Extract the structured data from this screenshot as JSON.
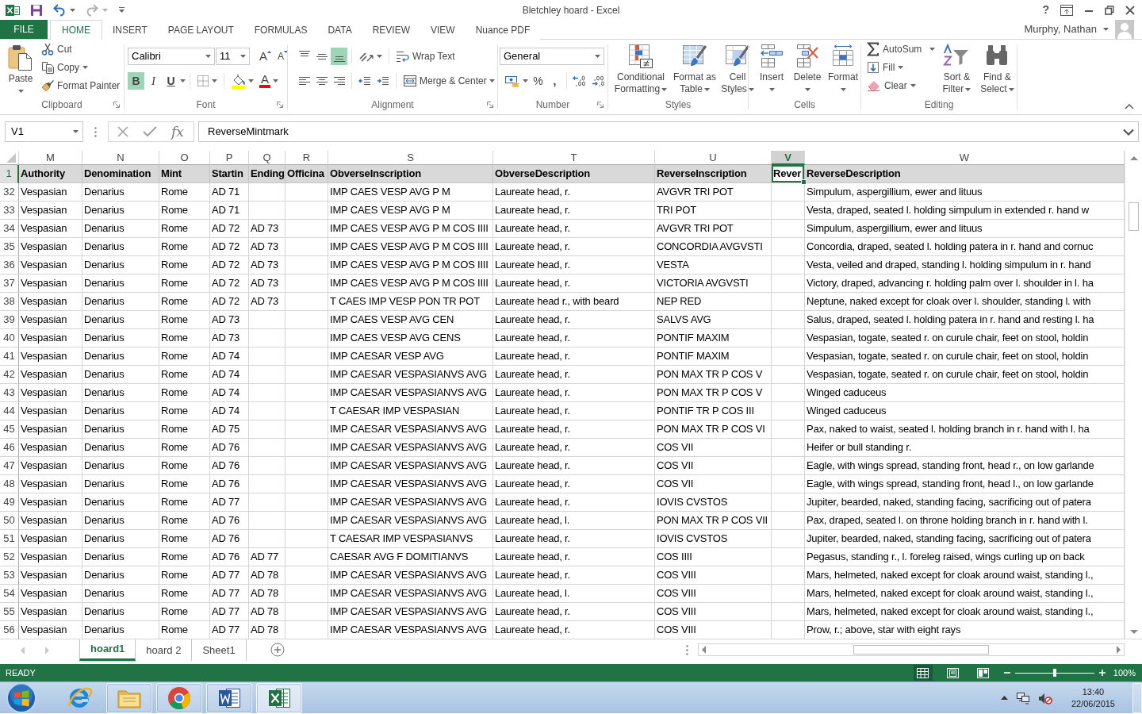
{
  "window": {
    "title": "Bletchley hoard - Excel",
    "help": "?"
  },
  "ribbon_tabs": [
    {
      "label": "FILE",
      "kind": "file",
      "selected": false
    },
    {
      "label": "HOME",
      "kind": "tab",
      "selected": true
    },
    {
      "label": "INSERT",
      "kind": "tab",
      "selected": false
    },
    {
      "label": "PAGE LAYOUT",
      "kind": "tab",
      "selected": false
    },
    {
      "label": "FORMULAS",
      "kind": "tab",
      "selected": false
    },
    {
      "label": "DATA",
      "kind": "tab",
      "selected": false
    },
    {
      "label": "REVIEW",
      "kind": "tab",
      "selected": false
    },
    {
      "label": "VIEW",
      "kind": "tab",
      "selected": false
    },
    {
      "label": "Nuance PDF",
      "kind": "tab",
      "selected": false
    }
  ],
  "account": {
    "name": "Murphy, Nathan"
  },
  "ribbon": {
    "clipboard": {
      "label": "Clipboard",
      "paste": "Paste",
      "cut": "Cut",
      "copy": "Copy",
      "format_painter": "Format Painter"
    },
    "font": {
      "label": "Font",
      "font_name": "Calibri",
      "font_size": "11",
      "grow": "A",
      "shrink": "A",
      "bold": {
        "label": "B",
        "on": true
      },
      "italic": {
        "label": "I",
        "on": false
      },
      "underline": {
        "label": "U",
        "on": false
      },
      "font_color": "A"
    },
    "alignment": {
      "label": "Alignment",
      "vertical": [
        {
          "kind": "top",
          "selected": false
        },
        {
          "kind": "middle",
          "selected": false
        },
        {
          "kind": "bottom",
          "selected": true
        }
      ],
      "horizontal": [
        {
          "kind": "left",
          "selected": false
        },
        {
          "kind": "center",
          "selected": false
        },
        {
          "kind": "right",
          "selected": false
        }
      ],
      "wrap_text": "Wrap Text",
      "merge_center": "Merge & Center"
    },
    "number": {
      "label": "Number",
      "format": "General",
      "percent": "%",
      "comma": ","
    },
    "styles": {
      "label": "Styles",
      "buttons": [
        "Conditional Formatting",
        "Format as Table",
        "Cell Styles"
      ]
    },
    "cells": {
      "label": "Cells",
      "buttons": [
        "Insert",
        "Delete",
        "Format"
      ]
    },
    "editing": {
      "label": "Editing",
      "autosum": "AutoSum",
      "fill": "Fill",
      "clear": "Clear",
      "sort_filter": "Sort & Filter",
      "find_select": "Find & Select"
    }
  },
  "formula_bar": {
    "name_box": "V1",
    "function_label": "fx",
    "formula": "ReverseMintmark"
  },
  "sheet": {
    "columns": [
      {
        "letter": "M",
        "selected": false
      },
      {
        "letter": "N",
        "selected": false
      },
      {
        "letter": "O",
        "selected": false
      },
      {
        "letter": "P",
        "selected": false
      },
      {
        "letter": "Q",
        "selected": false
      },
      {
        "letter": "R",
        "selected": false
      },
      {
        "letter": "S",
        "selected": false
      },
      {
        "letter": "T",
        "selected": false
      },
      {
        "letter": "U",
        "selected": false
      },
      {
        "letter": "V",
        "selected": true
      },
      {
        "letter": "W",
        "selected": false
      }
    ],
    "header_row": {
      "number": "1",
      "selected": true,
      "authority": "Authority",
      "denomination": "Denomination",
      "mint": "Mint",
      "starting": "Startin",
      "ending": "Ending",
      "officina": "Officina",
      "obverse_inscription": "ObverseInscription",
      "obverse_description": "ObverseDescription",
      "reverse_inscription": "ReverseInscription",
      "reverse_mintmark": "Rever",
      "reverse_description": "ReverseDescription"
    },
    "rows": [
      {
        "number": "32",
        "selected": false,
        "authority": "Vespasian",
        "denomination": "Denarius",
        "mint": "Rome",
        "starting": "AD 71",
        "obverse_inscription": "IMP CAES VESP AVG P M",
        "obverse_description": "Laureate head, r.",
        "reverse_inscription": "AVGVR TRI POT",
        "reverse_description": "Simpulum, aspergillium, ewer and lituus"
      },
      {
        "number": "33",
        "selected": false,
        "authority": "Vespasian",
        "denomination": "Denarius",
        "mint": "Rome",
        "starting": "AD 71",
        "obverse_inscription": "IMP CAES VESP AVG P M",
        "obverse_description": "Laureate head, r.",
        "reverse_inscription": "TRI POT",
        "reverse_description": "Vesta, draped, seated l. holding simpulum in extended r. hand w"
      },
      {
        "number": "34",
        "selected": false,
        "authority": "Vespasian",
        "denomination": "Denarius",
        "mint": "Rome",
        "starting": "AD 72",
        "ending": "AD 73",
        "obverse_inscription": "IMP CAES VESP AVG P M COS IIII",
        "obverse_description": "Laureate head, r.",
        "reverse_inscription": "AVGVR TRI POT",
        "reverse_description": "Simpulum, aspergillium, ewer and lituus"
      },
      {
        "number": "35",
        "selected": false,
        "authority": "Vespasian",
        "denomination": "Denarius",
        "mint": "Rome",
        "starting": "AD 72",
        "ending": "AD 73",
        "obverse_inscription": "IMP CAES VESP AVG P M COS IIII",
        "obverse_description": "Laureate head, r.",
        "reverse_inscription": "CONCORDIA AVGVSTI",
        "reverse_description": "Concordia, draped, seated l. holding patera in r. hand and cornuc"
      },
      {
        "number": "36",
        "selected": false,
        "authority": "Vespasian",
        "denomination": "Denarius",
        "mint": "Rome",
        "starting": "AD 72",
        "ending": "AD 73",
        "obverse_inscription": "IMP CAES VESP AVG P M COS IIII",
        "obverse_description": "Laureate head, r.",
        "reverse_inscription": "VESTA",
        "reverse_description": "Vesta, veiled and draped, standing l. holding simpulum in r. hand"
      },
      {
        "number": "37",
        "selected": false,
        "authority": "Vespasian",
        "denomination": "Denarius",
        "mint": "Rome",
        "starting": "AD 72",
        "ending": "AD 73",
        "obverse_inscription": "IMP CAES VESP AVG P M COS IIII",
        "obverse_description": "Laureate head, r.",
        "reverse_inscription": "VICTORIA AVGVSTI",
        "reverse_description": "Victory, draped, advancing r. holding palm over l. shoulder in l. ha"
      },
      {
        "number": "38",
        "selected": false,
        "authority": "Vespasian",
        "denomination": "Denarius",
        "mint": "Rome",
        "starting": "AD 72",
        "ending": "AD 73",
        "obverse_inscription": "T CAES IMP VESP PON TR POT",
        "obverse_description": "Laureate head r., with beard",
        "reverse_inscription": "NEP RED",
        "reverse_description": "Neptune, naked except for cloak over l. shoulder, standing l. with"
      },
      {
        "number": "39",
        "selected": false,
        "authority": "Vespasian",
        "denomination": "Denarius",
        "mint": "Rome",
        "starting": "AD 73",
        "obverse_inscription": "IMP CAES VESP AVG CEN",
        "obverse_description": "Laureate head, r.",
        "reverse_inscription": "SALVS AVG",
        "reverse_description": "Salus, draped, seated l. holding patera in r. hand and resting l. ha"
      },
      {
        "number": "40",
        "selected": false,
        "authority": "Vespasian",
        "denomination": "Denarius",
        "mint": "Rome",
        "starting": "AD 73",
        "obverse_inscription": "IMP CAES VESP AVG CENS",
        "obverse_description": "Laureate head, r.",
        "reverse_inscription": "PONTIF MAXIM",
        "reverse_description": "Vespasian, togate, seated r. on curule chair, feet on stool, holdin"
      },
      {
        "number": "41",
        "selected": false,
        "authority": "Vespasian",
        "denomination": "Denarius",
        "mint": "Rome",
        "starting": "AD 74",
        "obverse_inscription": "IMP CAESAR VESP AVG",
        "obverse_description": "Laureate head, r.",
        "reverse_inscription": "PONTIF MAXIM",
        "reverse_description": "Vespasian, togate, seated r. on curule chair, feet on stool, holdin"
      },
      {
        "number": "42",
        "selected": false,
        "authority": "Vespasian",
        "denomination": "Denarius",
        "mint": "Rome",
        "starting": "AD 74",
        "obverse_inscription": "IMP CAESAR VESPASIANVS AVG",
        "obverse_description": "Laureate head, r.",
        "reverse_inscription": "PON MAX TR P COS V",
        "reverse_description": "Vespasian, togate, seated r. on curule chair, feet on stool, holdin"
      },
      {
        "number": "43",
        "selected": false,
        "authority": "Vespasian",
        "denomination": "Denarius",
        "mint": "Rome",
        "starting": "AD 74",
        "obverse_inscription": "IMP CAESAR VESPASIANVS AVG",
        "obverse_description": "Laureate head, r.",
        "reverse_inscription": "PON MAX TR P COS V",
        "reverse_description": "Winged caduceus"
      },
      {
        "number": "44",
        "selected": false,
        "authority": "Vespasian",
        "denomination": "Denarius",
        "mint": "Rome",
        "starting": "AD 74",
        "obverse_inscription": "T CAESAR IMP VESPASIAN",
        "obverse_description": "Laureate head, r.",
        "reverse_inscription": "PONTIF TR P COS III",
        "reverse_description": "Winged caduceus"
      },
      {
        "number": "45",
        "selected": false,
        "authority": "Vespasian",
        "denomination": "Denarius",
        "mint": "Rome",
        "starting": "AD 75",
        "obverse_inscription": "IMP CAESAR VESPASIANVS AVG",
        "obverse_description": "Laureate head, r.",
        "reverse_inscription": "PON MAX TR P COS VI",
        "reverse_description": "Pax, naked to waist, seated l. holding branch in r. hand with l. ha"
      },
      {
        "number": "46",
        "selected": false,
        "authority": "Vespasian",
        "denomination": "Denarius",
        "mint": "Rome",
        "starting": "AD 76",
        "obverse_inscription": "IMP CAESAR VESPASIANVS AVG",
        "obverse_description": "Laureate head, r.",
        "reverse_inscription": "COS VII",
        "reverse_description": "Heifer or bull standing r."
      },
      {
        "number": "47",
        "selected": false,
        "authority": "Vespasian",
        "denomination": "Denarius",
        "mint": "Rome",
        "starting": "AD 76",
        "obverse_inscription": "IMP CAESAR VESPASIANVS AVG",
        "obverse_description": "Laureate head, r.",
        "reverse_inscription": "COS VII",
        "reverse_description": "Eagle, with wings spread, standing front, head r., on low garlande"
      },
      {
        "number": "48",
        "selected": false,
        "authority": "Vespasian",
        "denomination": "Denarius",
        "mint": "Rome",
        "starting": "AD 76",
        "obverse_inscription": "IMP CAESAR VESPASIANVS AVG",
        "obverse_description": "Laureate head, r.",
        "reverse_inscription": "COS VII",
        "reverse_description": "Eagle, with wings spread, standing front, head l., on low garlande"
      },
      {
        "number": "49",
        "selected": false,
        "authority": "Vespasian",
        "denomination": "Denarius",
        "mint": "Rome",
        "starting": "AD 77",
        "obverse_inscription": "IMP CAESAR VESPASIANVS AVG",
        "obverse_description": "Laureate head, r.",
        "reverse_inscription": "IOVIS CVSTOS",
        "reverse_description": "Jupiter, bearded, naked, standing facing, sacrificing out of patera"
      },
      {
        "number": "50",
        "selected": false,
        "authority": "Vespasian",
        "denomination": "Denarius",
        "mint": "Rome",
        "starting": "AD 76",
        "obverse_inscription": "IMP CAESAR VESPASIANVS AVG",
        "obverse_description": "Laureate head, l.",
        "reverse_inscription": "PON MAX TR P COS VII",
        "reverse_description": "Pax, draped, seated l. on throne holding branch in r. hand with l."
      },
      {
        "number": "51",
        "selected": false,
        "authority": "Vespasian",
        "denomination": "Denarius",
        "mint": "Rome",
        "starting": "AD 76",
        "obverse_inscription": "T CAESAR IMP VESPASIANVS",
        "obverse_description": "Laureate head, r.",
        "reverse_inscription": "IOVIS CVSTOS",
        "reverse_description": "Jupiter, bearded, naked, standing facing, sacrificing out of patera"
      },
      {
        "number": "52",
        "selected": false,
        "authority": "Vespasian",
        "denomination": "Denarius",
        "mint": "Rome",
        "starting": "AD 76",
        "ending": "AD 77",
        "obverse_inscription": "CAESAR AVG F DOMITIANVS",
        "obverse_description": "Laureate head, r.",
        "reverse_inscription": "COS IIII",
        "reverse_description": "Pegasus, standing r., l. foreleg raised, wings curling up on back"
      },
      {
        "number": "53",
        "selected": false,
        "authority": "Vespasian",
        "denomination": "Denarius",
        "mint": "Rome",
        "starting": "AD 77",
        "ending": "AD 78",
        "obverse_inscription": "IMP CAESAR VESPASIANVS AVG",
        "obverse_description": "Laureate head, r.",
        "reverse_inscription": "COS VIII",
        "reverse_description": "Mars, helmeted, naked except for cloak around waist, standing l.,"
      },
      {
        "number": "54",
        "selected": false,
        "authority": "Vespasian",
        "denomination": "Denarius",
        "mint": "Rome",
        "starting": "AD 77",
        "ending": "AD 78",
        "obverse_inscription": "IMP CAESAR VESPASIANVS AVG",
        "obverse_description": "Laureate head, l.",
        "reverse_inscription": "COS VIII",
        "reverse_description": "Mars, helmeted, naked except for cloak around waist, standing l.,"
      },
      {
        "number": "55",
        "selected": false,
        "authority": "Vespasian",
        "denomination": "Denarius",
        "mint": "Rome",
        "starting": "AD 77",
        "ending": "AD 78",
        "obverse_inscription": "IMP CAESAR VESPASIANVS AVG",
        "obverse_description": "Laureate head, r.",
        "reverse_inscription": "COS VIII",
        "reverse_description": "Mars, helmeted, naked except for cloak around waist, standing l.,"
      },
      {
        "number": "56",
        "selected": false,
        "authority": "Vespasian",
        "denomination": "Denarius",
        "mint": "Rome",
        "starting": "AD 77",
        "ending": "AD 78",
        "obverse_inscription": "IMP CAESAR VESPASIANVS AVG",
        "obverse_description": "Laureate head, r.",
        "reverse_inscription": "COS VIII",
        "reverse_description": "Prow, r.; above, star with eight rays"
      }
    ]
  },
  "sheet_tabs": [
    {
      "label": "hoard1",
      "selected": true
    },
    {
      "label": "hoard 2",
      "selected": false
    },
    {
      "label": "Sheet1",
      "selected": false
    }
  ],
  "status_bar": {
    "mode": "READY",
    "views": [
      {
        "kind": "normal",
        "selected": true
      },
      {
        "kind": "page_layout",
        "selected": false
      },
      {
        "kind": "page_break",
        "selected": false
      }
    ],
    "zoom": {
      "level": 0.5,
      "reading": "100%"
    }
  },
  "taskbar": {
    "apps": [
      {
        "kind": "ie",
        "running": false,
        "selected": false
      },
      {
        "kind": "explorer",
        "running": true,
        "selected": false
      },
      {
        "kind": "chrome",
        "running": true,
        "selected": false
      },
      {
        "kind": "word",
        "running": true,
        "selected": false
      },
      {
        "kind": "excel",
        "running": true,
        "selected": true
      }
    ],
    "time": "13:40",
    "date": "22/06/2015"
  }
}
